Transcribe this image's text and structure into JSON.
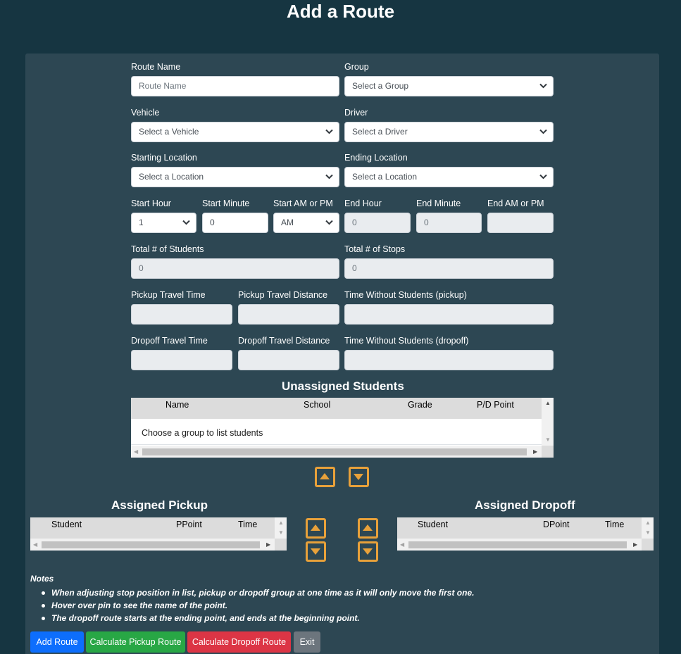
{
  "page_title": "Add a Route",
  "form": {
    "route_name": {
      "label": "Route Name",
      "placeholder": "Route Name"
    },
    "group": {
      "label": "Group",
      "selected": "Select a Group"
    },
    "vehicle": {
      "label": "Vehicle",
      "selected": "Select a Vehicle"
    },
    "driver": {
      "label": "Driver",
      "selected": "Select a Driver"
    },
    "starting_location": {
      "label": "Starting Location",
      "selected": "Select a Location"
    },
    "ending_location": {
      "label": "Ending Location",
      "selected": "Select a Location"
    },
    "start_hour": {
      "label": "Start Hour",
      "selected": "1"
    },
    "start_minute": {
      "label": "Start Minute",
      "value": "0"
    },
    "start_ampm": {
      "label": "Start AM or PM",
      "selected": "AM"
    },
    "end_hour": {
      "label": "End Hour",
      "value": "0"
    },
    "end_minute": {
      "label": "End Minute",
      "value": "0"
    },
    "end_ampm": {
      "label": "End AM or PM",
      "value": ""
    },
    "total_students": {
      "label": "Total # of Students",
      "value": "0"
    },
    "total_stops": {
      "label": "Total # of Stops",
      "value": "0"
    },
    "pickup_travel_time": {
      "label": "Pickup Travel Time",
      "value": ""
    },
    "pickup_travel_distance": {
      "label": "Pickup Travel Distance",
      "value": ""
    },
    "time_without_students_pickup": {
      "label": "Time Without Students (pickup)",
      "value": ""
    },
    "dropoff_travel_time": {
      "label": "Dropoff Travel Time",
      "value": ""
    },
    "dropoff_travel_distance": {
      "label": "Dropoff Travel Distance",
      "value": ""
    },
    "time_without_students_dropoff": {
      "label": "Time Without Students (dropoff)",
      "value": ""
    }
  },
  "unassigned": {
    "title": "Unassigned Students",
    "columns": [
      "Name",
      "School",
      "Grade",
      "P/D Point"
    ],
    "empty_message": "Choose a group to list students"
  },
  "assigned_pickup": {
    "title": "Assigned Pickup",
    "columns": [
      "Student",
      "PPoint",
      "Time"
    ]
  },
  "assigned_dropoff": {
    "title": "Assigned Dropoff",
    "columns": [
      "Student",
      "DPoint",
      "Time"
    ]
  },
  "notes": {
    "title": "Notes",
    "items": [
      "When adjusting stop position in list, pickup or dropoff group at one time as it will only move the first one.",
      "Hover over pin to see the name of the point.",
      "The dropoff route starts at the ending point, and ends at the beginning point."
    ]
  },
  "buttons": {
    "add_route": {
      "label": "Add Route",
      "color": "#0d6efd"
    },
    "calc_pickup": {
      "label": "Calculate Pickup Route",
      "color": "#28a745"
    },
    "calc_dropoff": {
      "label": "Calculate Dropoff Route",
      "color": "#dc3545"
    },
    "exit": {
      "label": "Exit",
      "color": "#6c757d"
    }
  },
  "colors": {
    "background": "#163541",
    "panel": "#2d4753",
    "move_button_accent": "#e8a13a"
  },
  "icons": {
    "move_up": "arrow-up-icon",
    "move_down": "arrow-down-icon",
    "select_chevron": "chevron-down-icon"
  }
}
